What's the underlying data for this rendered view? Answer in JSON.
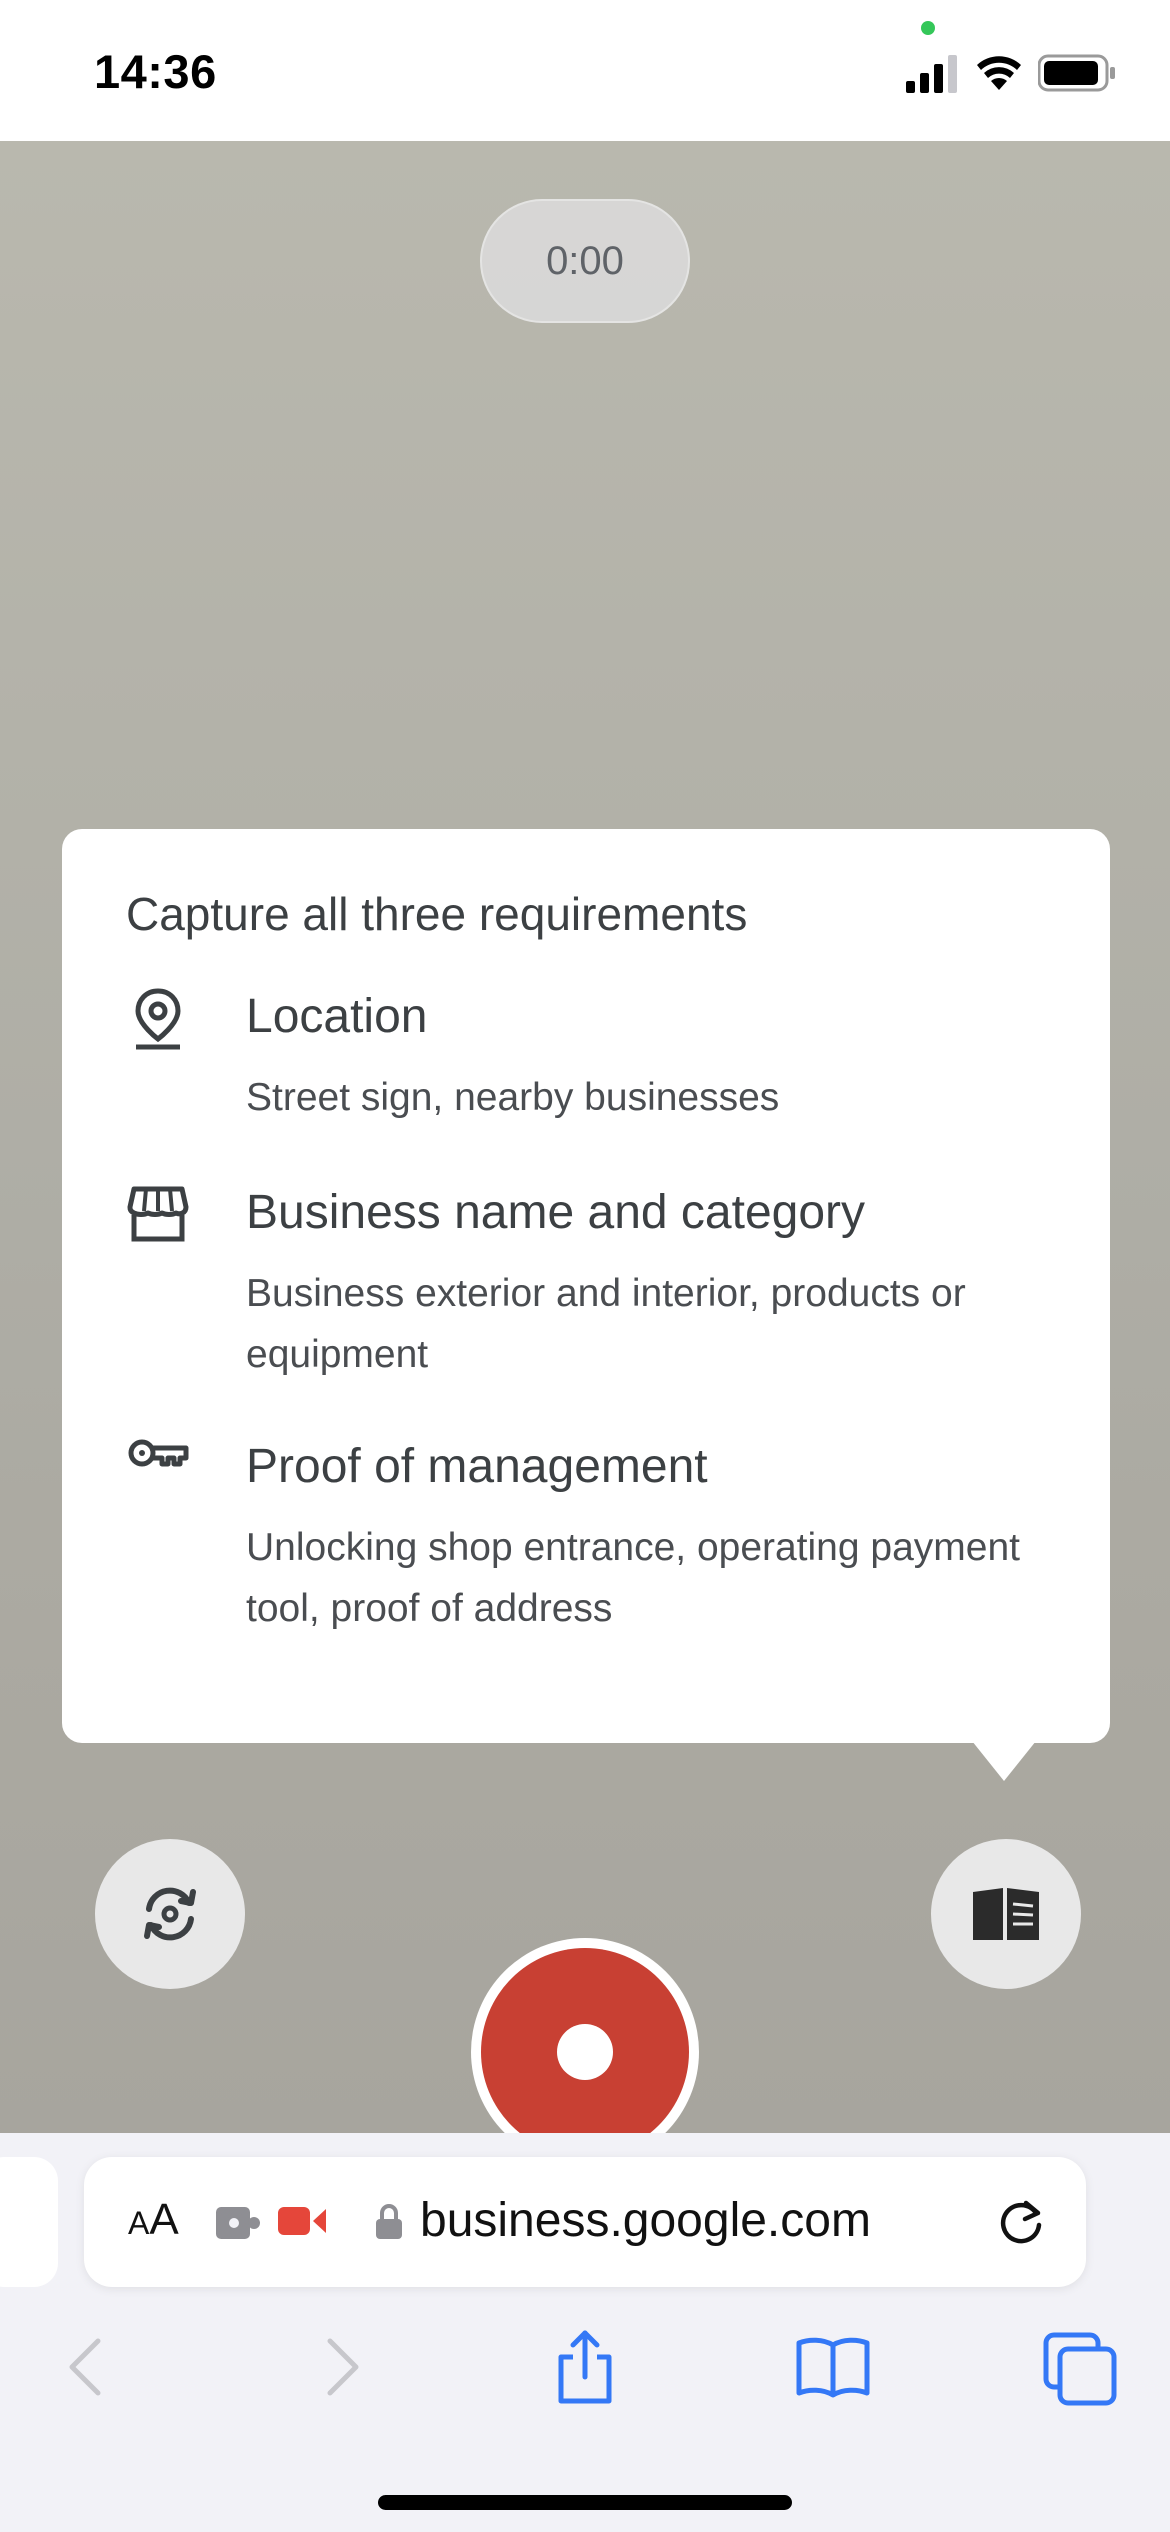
{
  "status_bar": {
    "time": "14:36"
  },
  "camera": {
    "timer": "0:00"
  },
  "requirements_card": {
    "title": "Capture all three requirements",
    "items": [
      {
        "icon": "location-pin-icon",
        "title": "Location",
        "description": "Street sign, nearby businesses"
      },
      {
        "icon": "storefront-icon",
        "title": "Business name and category",
        "description": "Business exterior and interior, products or equipment"
      },
      {
        "icon": "key-icon",
        "title": "Proof of management",
        "description": "Unlocking shop entrance, operating payment tool, proof of address"
      }
    ]
  },
  "controls": {
    "left": "flip-camera-icon",
    "center": "record-button",
    "right": "guide-book-icon",
    "record_color": "#c84033"
  },
  "safari": {
    "text_size_large": "A",
    "text_size_small": "A",
    "url": "business.google.com",
    "accent_color": "#3478f6"
  }
}
